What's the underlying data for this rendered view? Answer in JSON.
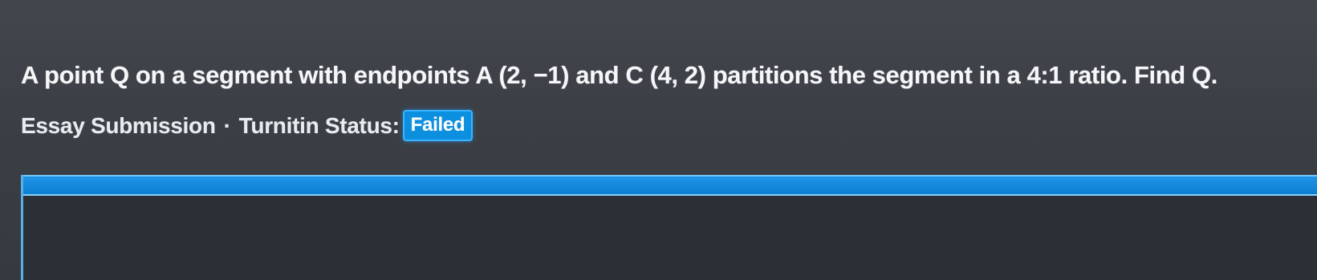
{
  "question": {
    "text": "A point Q on a segment with endpoints A (2, −1) and C (4, 2) partitions the segment in a 4:1 ratio. Find Q."
  },
  "submission": {
    "label": "Essay Submission",
    "separator": "·",
    "status_label": "Turnitin Status:",
    "status_value": "Failed"
  },
  "colors": {
    "badge": "#0d8fe0",
    "panel_header": "#1f95e6"
  }
}
